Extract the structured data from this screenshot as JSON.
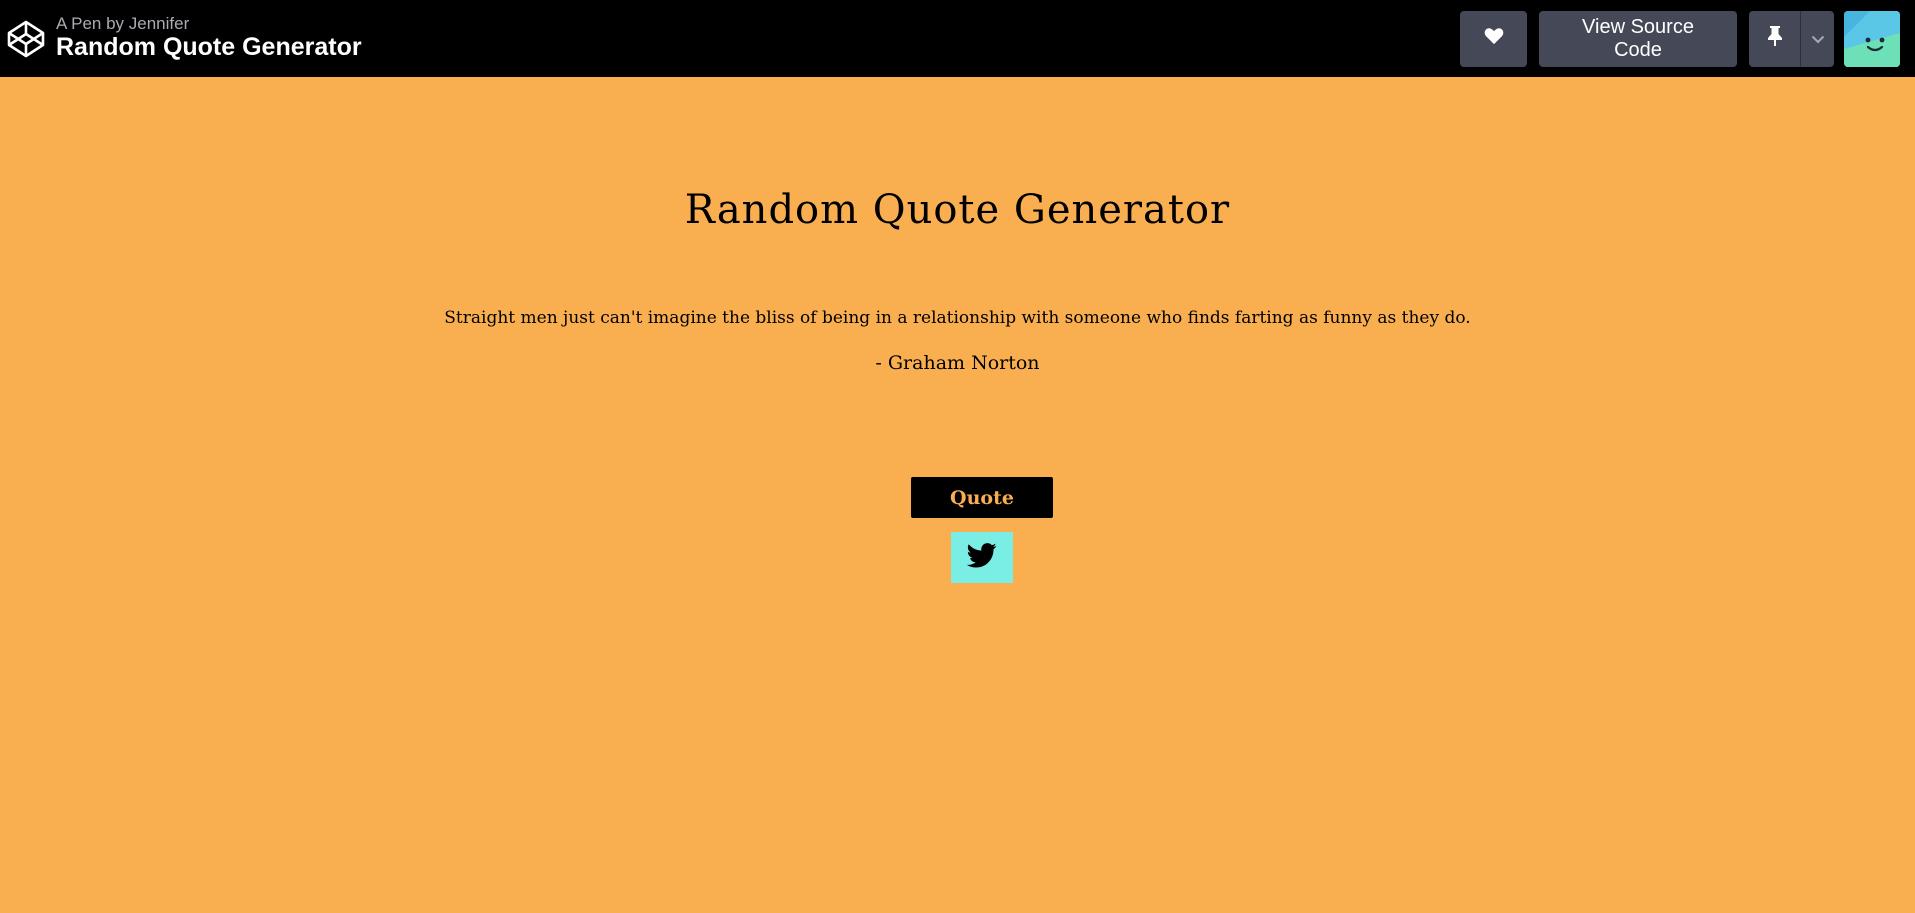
{
  "header": {
    "byline": "A Pen by Jennifer",
    "title": "Random Quote Generator",
    "icons": {
      "logo": "codepen-logo-icon",
      "heart": "heart-icon",
      "pin": "pin-icon",
      "caret": "chevron-down-icon",
      "avatar": "avatar-icon"
    },
    "buttons": {
      "view_source": "View Source Code"
    }
  },
  "app": {
    "title": "Random Quote Generator",
    "quote": "Straight men just can't imagine the bliss of being in a relationship with someone who finds farting as funny as they do.",
    "author": "- Graham Norton",
    "quote_button": "Quote",
    "tweet_icon": "twitter-icon"
  },
  "colors": {
    "background": "#f9ae50",
    "topbar": "#000000",
    "button": "#444857",
    "tweet_button": "#7aeee4"
  }
}
